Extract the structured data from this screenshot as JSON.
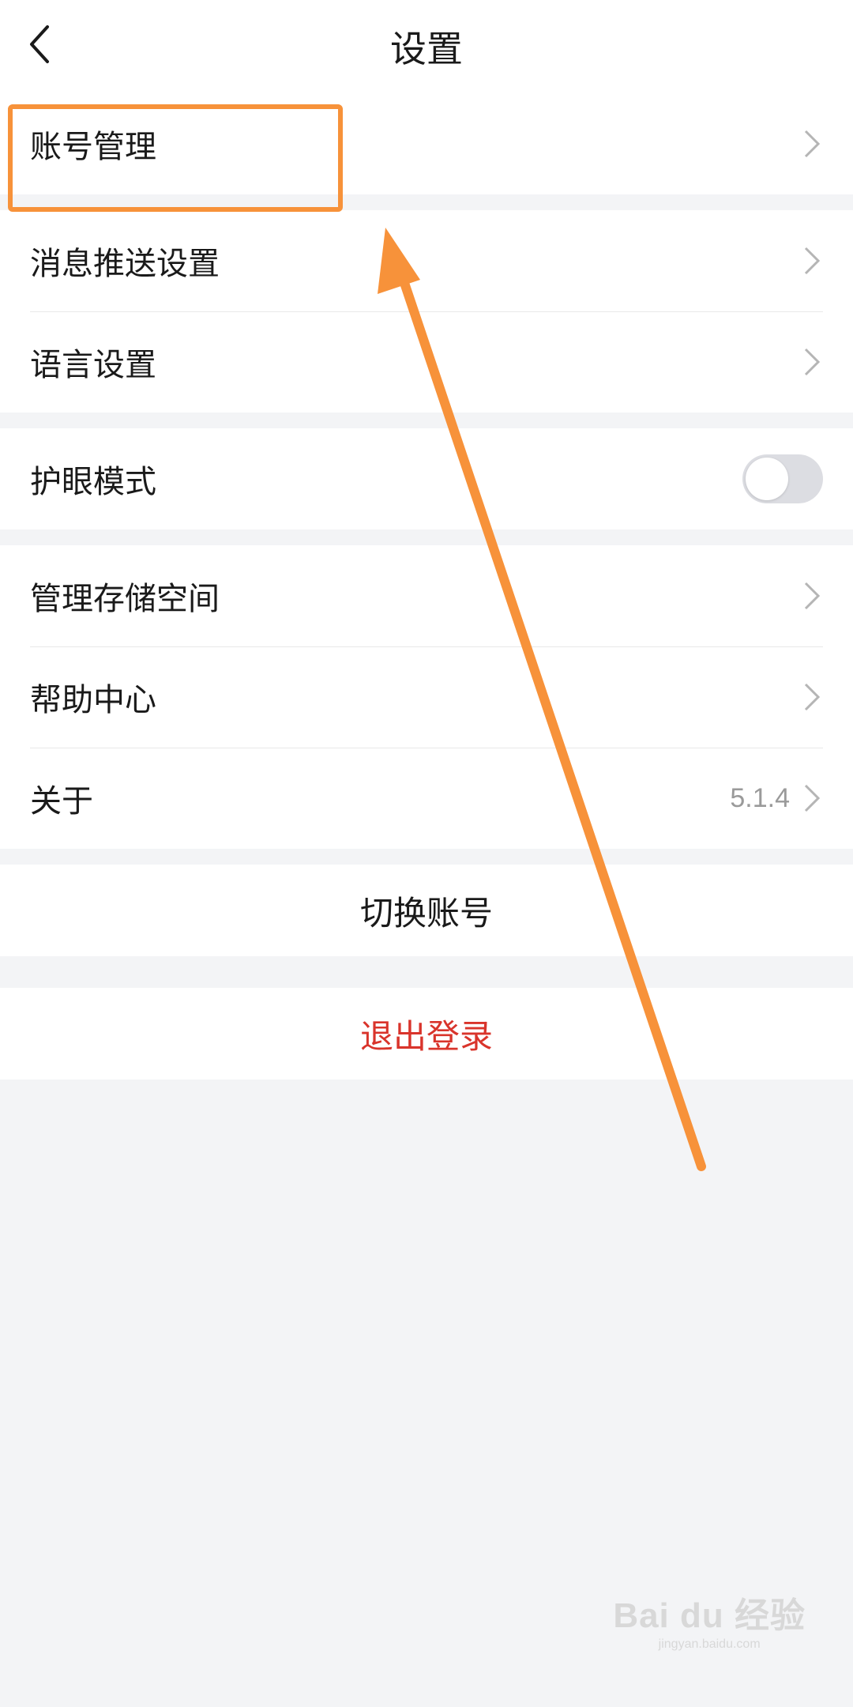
{
  "header": {
    "title": "设置"
  },
  "groups": [
    {
      "items": [
        {
          "label": "账号管理"
        }
      ]
    },
    {
      "items": [
        {
          "label": "消息推送设置"
        },
        {
          "label": "语言设置"
        }
      ]
    },
    {
      "items": [
        {
          "label": "护眼模式",
          "toggle_on": false
        }
      ]
    },
    {
      "items": [
        {
          "label": "管理存储空间"
        },
        {
          "label": "帮助中心"
        },
        {
          "label": "关于",
          "value": "5.1.4"
        }
      ]
    }
  ],
  "actions": {
    "switch_account": "切换账号",
    "logout": "退出登录"
  },
  "colors": {
    "annotation": "#f7923a",
    "logout_text": "#d9342b",
    "background": "#f3f4f6"
  },
  "icons": {
    "back": "back-arrow-icon",
    "chevron": "chevron-right-icon"
  },
  "watermark": {
    "main": "Bai du 经验",
    "sub": "jingyan.baidu.com"
  }
}
